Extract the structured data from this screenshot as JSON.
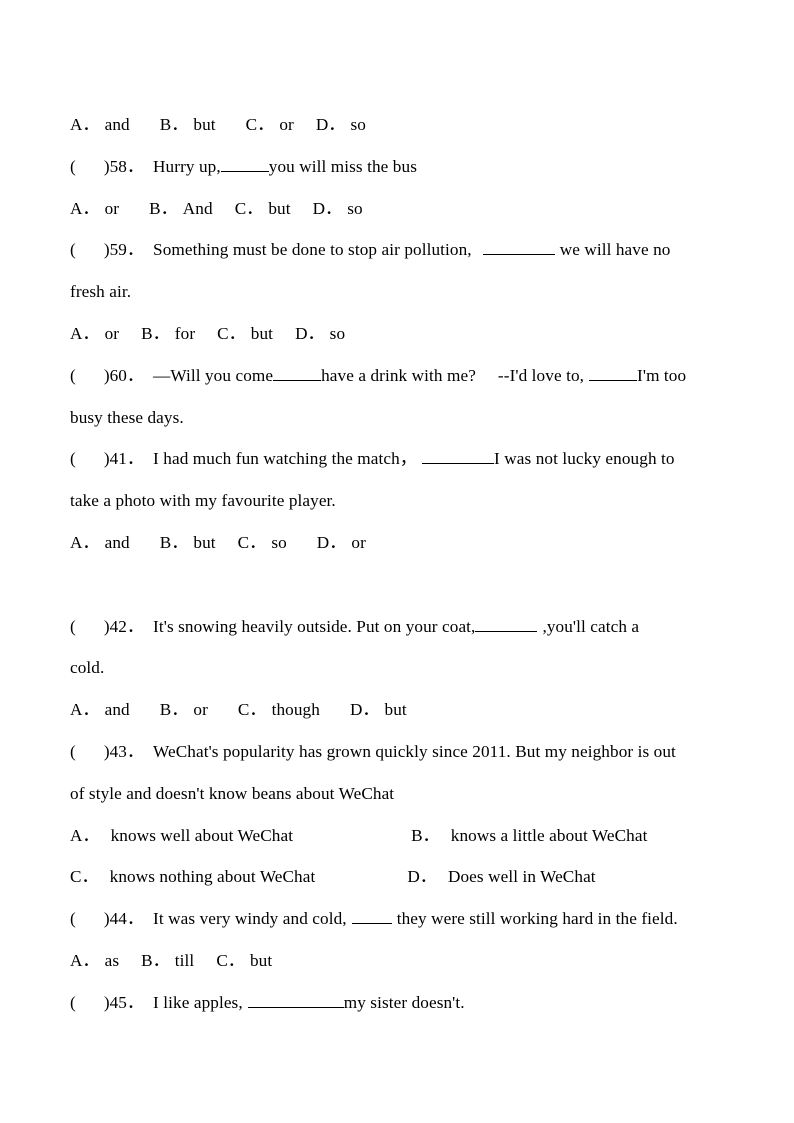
{
  "document": {
    "type": "english-grammar-worksheet",
    "topic": "conjunctions multiple choice",
    "page_background": "#ffffff",
    "text_color": "#000000"
  },
  "lines": {
    "opt_57": {
      "a_label": "A．",
      "a_text": "and",
      "b_label": "B．",
      "b_text": "but",
      "c_label": "C．",
      "c_text": "or",
      "d_label": "D．",
      "d_text": "so"
    },
    "q58": {
      "paren_open": "(",
      "paren_close": ")",
      "number": "58．",
      "text_before": "Hurry up,",
      "text_after": "you will miss the bus"
    },
    "opt_58": {
      "a_label": "A．",
      "a_text": "or",
      "b_label": "B．",
      "b_text": "And",
      "c_label": "C．",
      "c_text": "but",
      "d_label": "D．",
      "d_text": "so"
    },
    "q59": {
      "paren_open": "(",
      "paren_close": ")",
      "number": "59．",
      "text_before": "Something must be done to stop air pollution,",
      "text_after": "we will have no",
      "continuation": "fresh air."
    },
    "opt_59": {
      "a_label": "A．",
      "a_text": "or",
      "b_label": "B．",
      "b_text": "for",
      "c_label": "C．",
      "c_text": "but",
      "d_label": "D．",
      "d_text": "so"
    },
    "q60": {
      "paren_open": "(",
      "paren_close": ")",
      "number": "60．",
      "text_before": "—Will you come",
      "text_mid": "have a drink with me?",
      "text_mid2": "--I'd love to,",
      "text_after": "I'm too",
      "continuation": "busy these days."
    },
    "q41": {
      "paren_open": "(",
      "paren_close": ")",
      "number": "41．",
      "text_before": "I had much fun watching the match，",
      "text_after": "I was not lucky enough to",
      "continuation": "take a photo with my favourite player."
    },
    "opt_41": {
      "a_label": "A．",
      "a_text": "and",
      "b_label": "B．",
      "b_text": "but",
      "c_label": "C．",
      "c_text": "so",
      "d_label": "D．",
      "d_text": "or"
    },
    "q42": {
      "paren_open": "(",
      "paren_close": ")",
      "number": "42．",
      "text_before": "It's snowing heavily outside. Put on your coat,",
      "text_after": ",you'll catch a",
      "continuation": "cold."
    },
    "opt_42": {
      "a_label": "A．",
      "a_text": "and",
      "b_label": "B．",
      "b_text": "or",
      "c_label": "C．",
      "c_text": "though",
      "d_label": "D．",
      "d_text": "but"
    },
    "q43": {
      "paren_open": "(",
      "paren_close": ")",
      "number": "43．",
      "text": "WeChat's popularity has grown quickly since 2011. But my neighbor is out",
      "continuation": "of style and doesn't know beans about WeChat"
    },
    "opt_43": {
      "a_label": "A．",
      "a_text": "knows well about WeChat",
      "b_label": "B．",
      "b_text": "knows a little about WeChat",
      "c_label": "C．",
      "c_text": "knows nothing about WeChat",
      "d_label": "D．",
      "d_text": "Does well in WeChat"
    },
    "q44": {
      "paren_open": "(",
      "paren_close": ")",
      "number": "44．",
      "text_before": "It was very windy and cold,",
      "text_after": "they were still working hard in the field."
    },
    "opt_44": {
      "a_label": "A．",
      "a_text": "as",
      "b_label": "B．",
      "b_text": "till",
      "c_label": "C．",
      "c_text": "but"
    },
    "q45": {
      "paren_open": "(",
      "paren_close": ")",
      "number": "45．",
      "text_before": "I like apples,",
      "text_after": "my sister doesn't."
    }
  }
}
